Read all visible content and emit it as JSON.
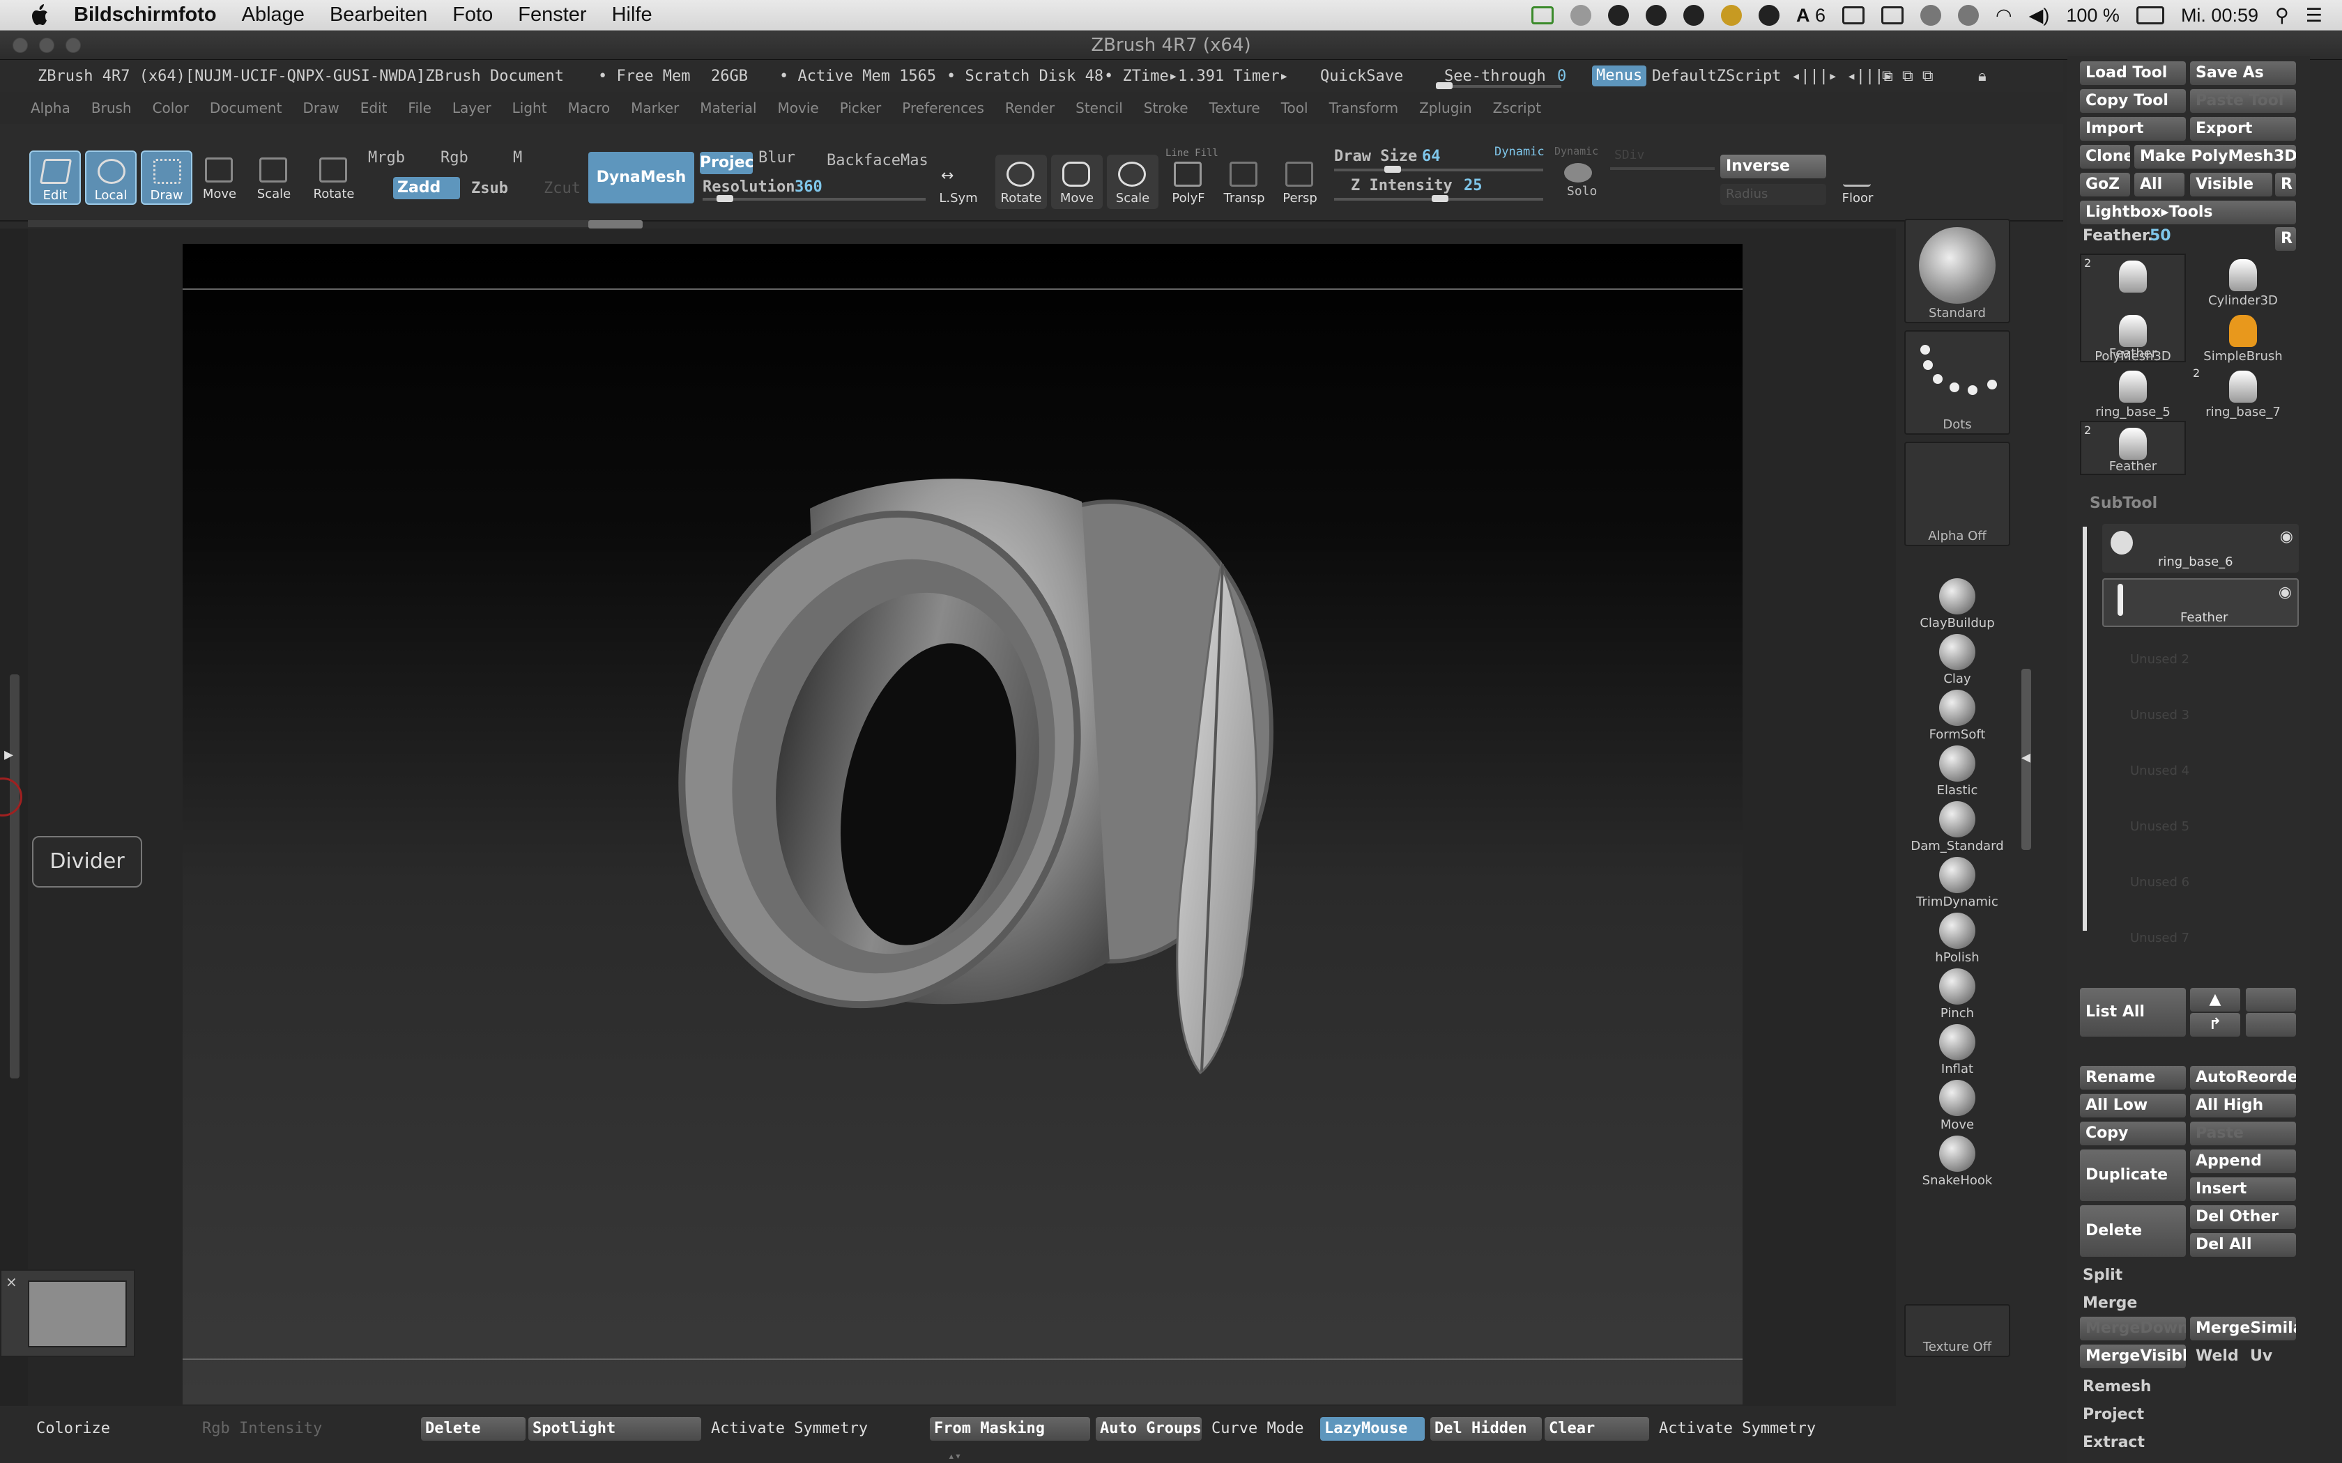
{
  "macos": {
    "menus": [
      "Bildschirmfoto",
      "Ablage",
      "Bearbeiten",
      "Foto",
      "Fenster",
      "Hilfe"
    ],
    "battery": "100 %",
    "clock": "Mi. 00:59",
    "adobe_count": "6"
  },
  "window": {
    "title": "ZBrush 4R7 (x64)"
  },
  "info": {
    "doc": "ZBrush 4R7 (x64)[NUJM-UCIF-QNPX-GUSI-NWDA]ZBrush Document",
    "free_mem": "• Free Mem",
    "free_mem_val": "26GB",
    "active_mem": "• Active Mem 1565",
    "scratch": "• Scratch Disk 48",
    "ztime": "• ZTime▸1.391 Timer▸",
    "quicksave": "QuickSave",
    "seethrough": "See-through",
    "seethrough_val": "0",
    "menus": "Menus",
    "defaultzscript": "DefaultZScript"
  },
  "menubar": [
    "Alpha",
    "Brush",
    "Color",
    "Document",
    "Draw",
    "Edit",
    "File",
    "Layer",
    "Light",
    "Macro",
    "Marker",
    "Material",
    "Movie",
    "Picker",
    "Preferences",
    "Render",
    "Stencil",
    "Stroke",
    "Texture",
    "Tool",
    "Transform",
    "Zplugin",
    "Zscript"
  ],
  "shelf": {
    "edit": "Edit",
    "local": "Local",
    "draw": "Draw",
    "move": "Move",
    "scale": "Scale",
    "rotate": "Rotate",
    "mrgb": "Mrgb",
    "rgb": "Rgb",
    "m": "M",
    "zadd": "Zadd",
    "zsub": "Zsub",
    "zcut": "Zcut",
    "dynamesh": "DynaMesh",
    "project": "Projec",
    "blur": "Blur",
    "backface": "BackfaceMas",
    "resolution": "Resolution",
    "resolution_val": "360",
    "lsym": "L.Sym",
    "rotate2": "Rotate",
    "move2": "Move",
    "scale2": "Scale",
    "polyf": "PolyF",
    "transp": "Transp",
    "persp": "Persp",
    "draw_size": "Draw Size",
    "draw_size_val": "64",
    "z_intensity": "Z Intensity",
    "z_intensity_val": "25",
    "dynamic": "Dynamic",
    "solo": "Solo",
    "inverse": "Inverse",
    "floor": "Floor",
    "line_fill": "Line Fill",
    "sdiv": "SDiv",
    "radius": "Radius"
  },
  "left": {
    "divider": "Divider"
  },
  "brushes": {
    "slots": [
      {
        "label": "Standard"
      },
      {
        "label": "Dots"
      },
      {
        "label": "Alpha  Off"
      }
    ],
    "items": [
      "ClayBuildup",
      "Clay",
      "FormSoft",
      "Elastic",
      "Dam_Standard",
      "TrimDynamic",
      "hPolish",
      "Pinch",
      "Inflat",
      "Move",
      "SnakeHook"
    ],
    "texture": "Texture  Off"
  },
  "right": {
    "load_tool": "Load Tool",
    "save_as": "Save As",
    "copy_tool": "Copy Tool",
    "paste_tool": "Paste Tool",
    "import": "Import",
    "export": "Export",
    "clone": "Clone",
    "make_polymesh": "Make PolyMesh3D",
    "goz": "GoZ",
    "all": "All",
    "visible": "Visible",
    "r": "R",
    "lightbox_tools": "Lightbox▸Tools",
    "feather_label": "Feather.",
    "feather_val": "50",
    "tool_thumbs": [
      {
        "label": "Feather",
        "badge": "2"
      },
      {
        "label": "Cylinder3D",
        "badge": ""
      },
      {
        "label": "PolyMesh3D",
        "badge": ""
      },
      {
        "label": "SimpleBrush",
        "badge": ""
      },
      {
        "label": "ring_base_5",
        "badge": ""
      },
      {
        "label": "ring_base_7",
        "badge": "2"
      },
      {
        "label": "Feather",
        "badge": "2"
      }
    ],
    "subtool": "SubTool",
    "subtools": [
      "ring_base_6",
      "Feather"
    ],
    "unused": [
      "Unused 2",
      "Unused 3",
      "Unused 4",
      "Unused 5",
      "Unused 6",
      "Unused 7"
    ],
    "list_all": "List All",
    "rename": "Rename",
    "autoreorder": "AutoReorder",
    "all_low": "All Low",
    "all_high": "All High",
    "copy": "Copy",
    "paste": "Paste",
    "duplicate": "Duplicate",
    "append": "Append",
    "insert": "Insert",
    "delete": "Delete",
    "del_other": "Del Other",
    "del_all": "Del All",
    "split": "Split",
    "merge": "Merge",
    "mergedown": "MergeDown",
    "mergesimilar": "MergeSimilar",
    "mergevisible": "MergeVisible",
    "weld": "Weld",
    "uv": "Uv",
    "remesh": "Remesh",
    "project": "Project",
    "extract": "Extract"
  },
  "bottom": {
    "colorize": "Colorize",
    "rgb_intensity": "Rgb Intensity",
    "delete": "Delete",
    "spotlight": "Spotlight",
    "activate_symmetry": "Activate Symmetry",
    "from_masking": "From Masking",
    "auto_groups": "Auto Groups",
    "curve_mode": "Curve Mode",
    "lazymouse": "LazyMouse",
    "del_hidden": "Del Hidden",
    "clear": "Clear",
    "activate_symmetry2": "Activate Symmetry"
  },
  "colors": {
    "accent": "#5e96bd",
    "highlight": "#7fc6ea"
  }
}
